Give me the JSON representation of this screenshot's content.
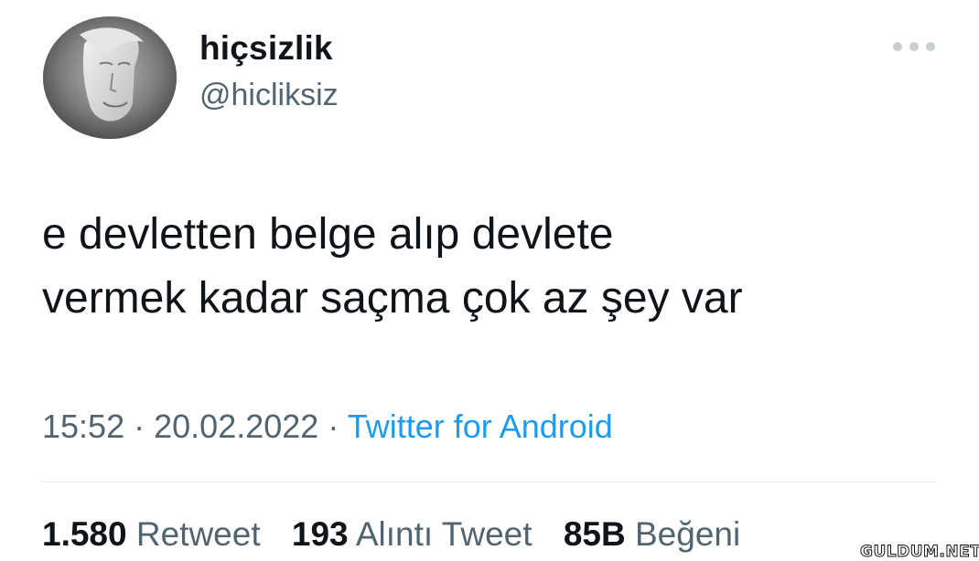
{
  "user": {
    "display_name": "hiçsizlik",
    "handle": "@hicliksiz"
  },
  "tweet": {
    "text_line1": "e devletten belge alıp devlete",
    "text_line2": "vermek kadar saçma çok az şey var",
    "time": "15:52",
    "date": "20.02.2022",
    "separator": "·",
    "source": "Twitter for Android"
  },
  "stats": {
    "retweets_count": "1.580",
    "retweets_label": "Retweet",
    "quotes_count": "193",
    "quotes_label": "Alıntı Tweet",
    "likes_count": "85B",
    "likes_label": "Beğeni"
  },
  "watermark": "GULDUM.NET",
  "icons": {
    "more": "more-dots-icon",
    "avatar": "avatar-image"
  },
  "colors": {
    "text_primary": "#0f1419",
    "text_secondary": "#536471",
    "link": "#1d9bf0",
    "divider": "#e6ecf0"
  }
}
